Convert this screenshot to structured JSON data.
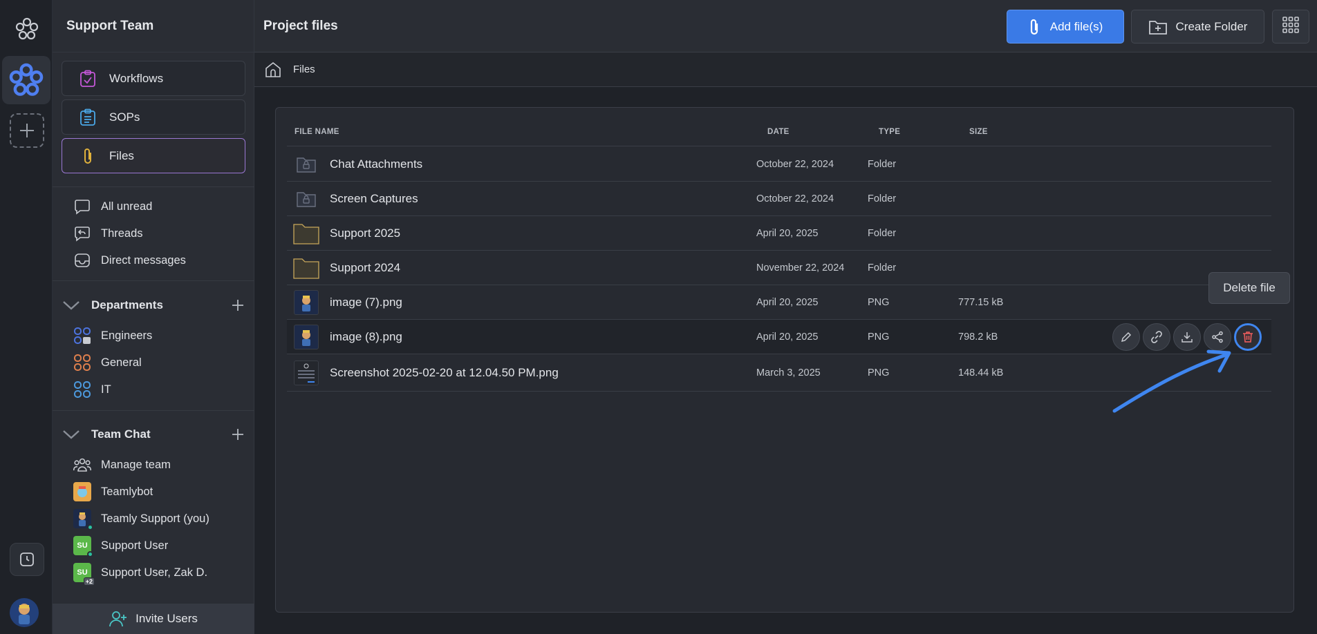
{
  "sidebar": {
    "team_name": "Support Team",
    "nav": [
      {
        "label": "Workflows",
        "icon": "clipboard-check-icon"
      },
      {
        "label": "SOPs",
        "icon": "clipboard-list-icon"
      },
      {
        "label": "Files",
        "icon": "paperclip-icon"
      }
    ],
    "inbox": [
      {
        "label": "All unread",
        "icon": "chat-bubble-icon"
      },
      {
        "label": "Threads",
        "icon": "reply-bubble-icon"
      },
      {
        "label": "Direct messages",
        "icon": "inbox-icon"
      }
    ],
    "departments": {
      "title": "Departments",
      "items": [
        {
          "label": "Engineers",
          "color": "#4d74e0"
        },
        {
          "label": "General",
          "color": "#e0804d"
        },
        {
          "label": "IT",
          "color": "#4d9be0"
        }
      ]
    },
    "team_chat": {
      "title": "Team Chat",
      "items": [
        {
          "label": "Manage team",
          "icon": "people-icon"
        },
        {
          "label": "Teamlybot",
          "icon": "bot-avatar"
        },
        {
          "label": "Teamly Support (you)",
          "icon": "user-avatar"
        },
        {
          "label": "Support User",
          "initials": "SU",
          "color": "#5bb84a"
        },
        {
          "label": "Support User, Zak D.",
          "initials": "SU",
          "color": "#5bb84a",
          "extra": "+2"
        }
      ]
    },
    "invite_label": "Invite Users"
  },
  "header": {
    "title": "Project files",
    "add_files_label": "Add file(s)",
    "create_folder_label": "Create Folder"
  },
  "breadcrumb": {
    "current": "Files"
  },
  "table": {
    "columns": [
      "FILE NAME",
      "DATE",
      "TYPE",
      "SIZE"
    ],
    "rows": [
      {
        "name": "Chat Attachments",
        "date": "October 22, 2024",
        "type": "Folder",
        "size": "",
        "icon": "locked-folder-icon"
      },
      {
        "name": "Screen Captures",
        "date": "October 22, 2024",
        "type": "Folder",
        "size": "",
        "icon": "locked-folder-icon"
      },
      {
        "name": "Support 2025",
        "date": "April 20, 2025",
        "type": "Folder",
        "size": "",
        "icon": "folder-icon"
      },
      {
        "name": "Support 2024",
        "date": "November 22, 2024",
        "type": "Folder",
        "size": "",
        "icon": "folder-icon"
      },
      {
        "name": "image (7).png",
        "date": "April 20, 2025",
        "type": "PNG",
        "size": "777.15 kB",
        "icon": "image-thumbnail"
      },
      {
        "name": "image (8).png",
        "date": "April 20, 2025",
        "type": "PNG",
        "size": "798.2 kB",
        "icon": "image-thumbnail"
      },
      {
        "name": "Screenshot 2025-02-20 at 12.04.50 PM.png",
        "date": "March 3, 2025",
        "type": "PNG",
        "size": "148.44 kB",
        "icon": "screenshot-thumbnail"
      }
    ]
  },
  "tooltip": "Delete file",
  "colors": {
    "accent": "#3a7ae6",
    "delete": "#e05a5a",
    "folder": "#c9a85a",
    "active_border": "#9b78d4"
  }
}
